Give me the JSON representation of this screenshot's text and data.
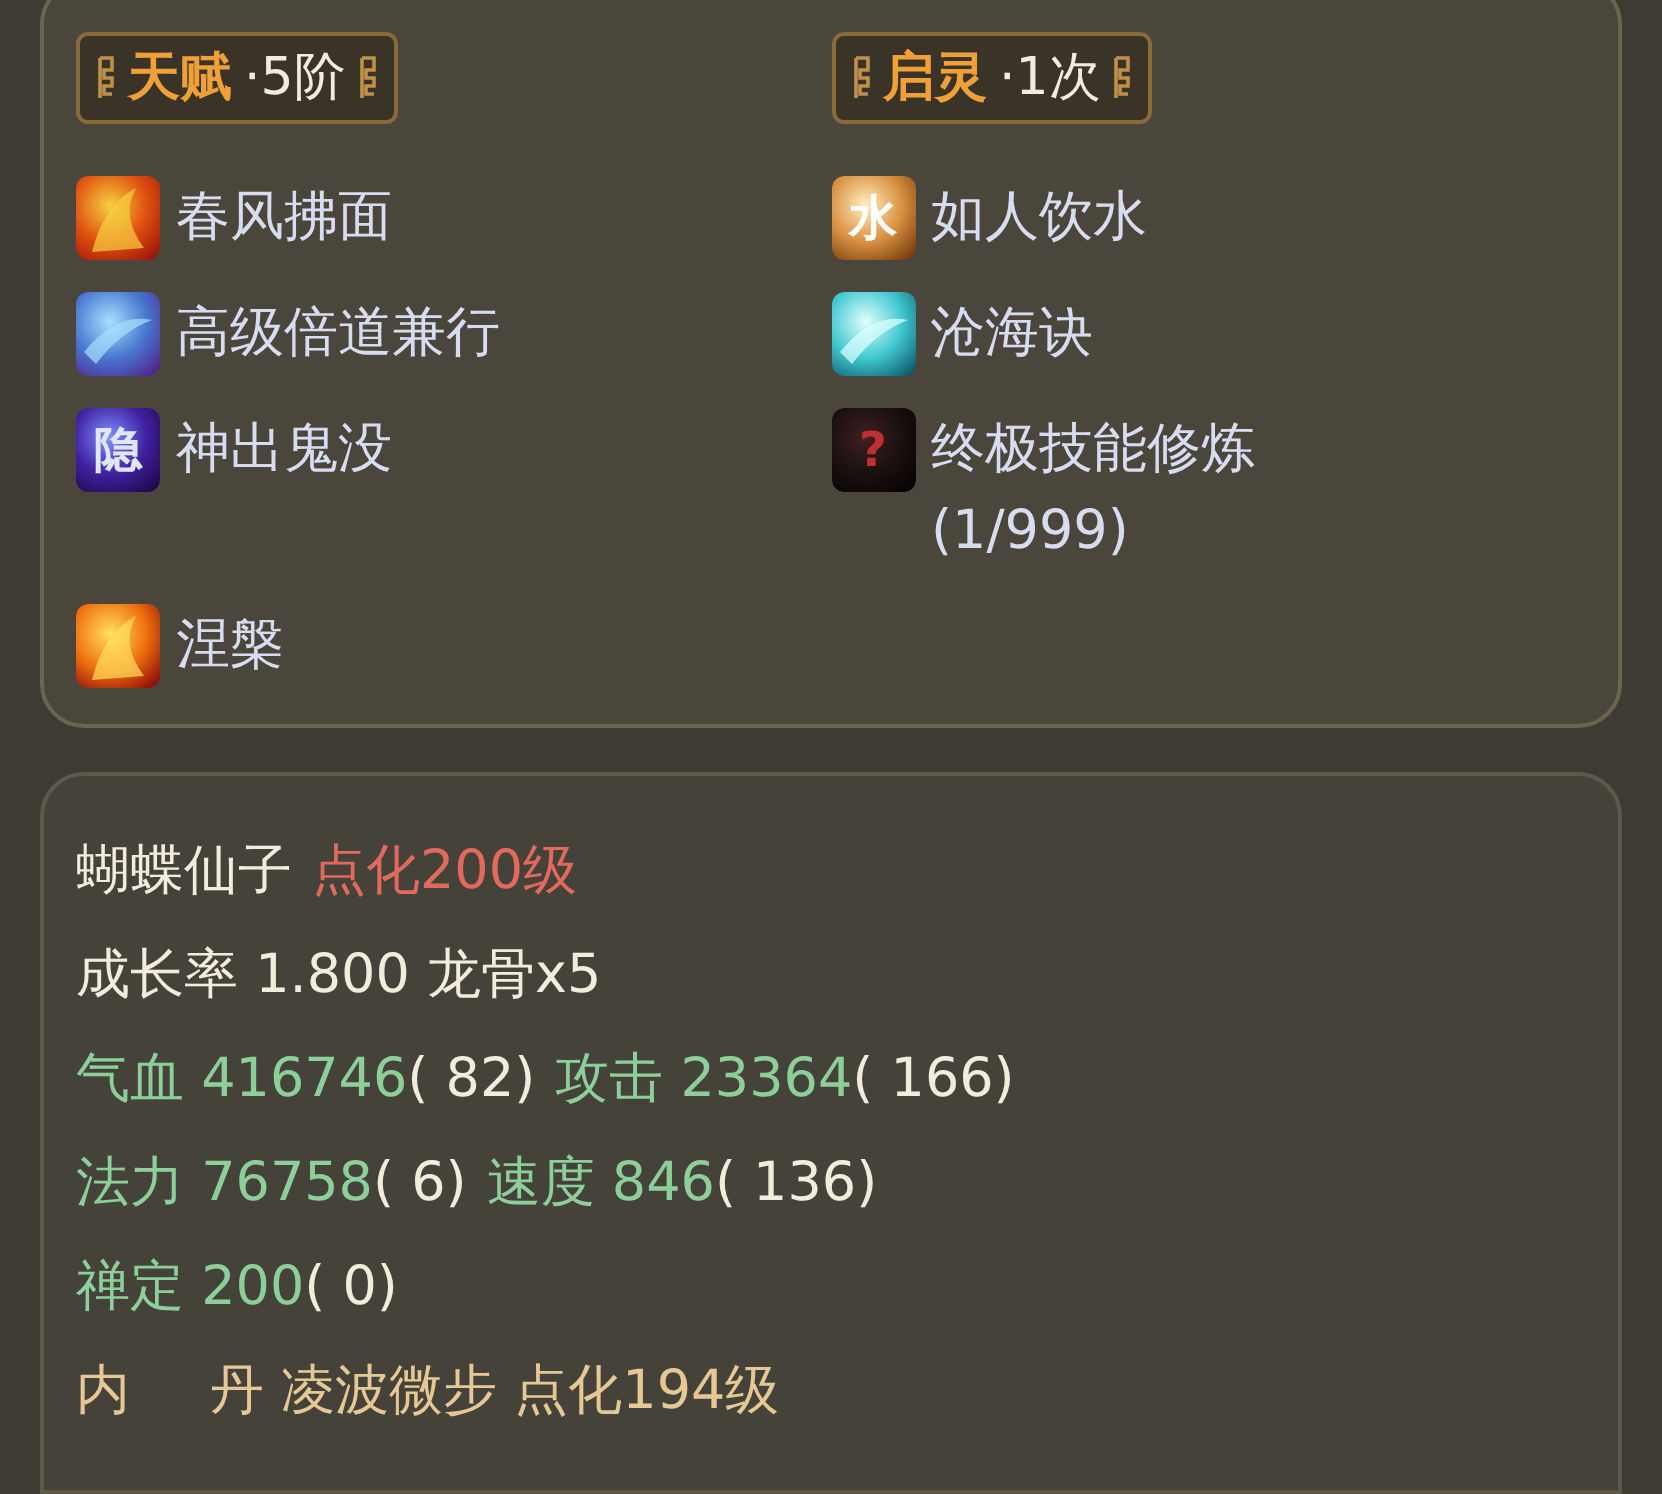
{
  "talent": {
    "title": "天赋",
    "value": "·5阶"
  },
  "awakening": {
    "title": "启灵",
    "value": "·1次"
  },
  "talent_skills": [
    {
      "name": "春风拂面",
      "kind": "fire"
    },
    {
      "name": "高级倍道兼行",
      "kind": "wind"
    },
    {
      "name": "神出鬼没",
      "kind": "stealth",
      "glyph": "隐"
    },
    {
      "name": "涅槃",
      "kind": "phoenix"
    }
  ],
  "awakening_skills": [
    {
      "name": "如人饮水",
      "kind": "water",
      "glyph": "水"
    },
    {
      "name": "沧海诀",
      "kind": "wave"
    },
    {
      "name": "终极技能修炼",
      "kind": "unknown",
      "glyph": "?",
      "note": "(1/999)"
    }
  ],
  "stats": [
    [
      {
        "text": "蝴蝶仙子",
        "color": "#f2ecdc"
      },
      {
        "text": "点化200级",
        "color": "#e26a5c"
      }
    ],
    [
      {
        "text": "成长率 1.800 龙骨x5",
        "color": "#f2ecdc"
      }
    ],
    [
      {
        "text": "气血 416746",
        "color": "#8ccf98"
      },
      {
        "text": "( 82)",
        "color": "#f2ecdc"
      },
      {
        "text": "攻击 23364",
        "color": "#8ccf98"
      },
      {
        "text": "( 166)",
        "color": "#f2ecdc"
      }
    ],
    [
      {
        "text": "法力 76758",
        "color": "#8ccf98"
      },
      {
        "text": "( 6)",
        "color": "#f2ecdc"
      },
      {
        "text": "速度 846",
        "color": "#8ccf98"
      },
      {
        "text": "( 136)",
        "color": "#f2ecdc"
      }
    ],
    [
      {
        "text": "禅定 200",
        "color": "#8ccf98"
      },
      {
        "text": "( 0)",
        "color": "#f2ecdc"
      }
    ],
    [
      {
        "text": "内",
        "color": "#e6c894"
      },
      {
        "text": "丹 凌波微步 点化194级",
        "color": "#e6c894"
      }
    ]
  ]
}
